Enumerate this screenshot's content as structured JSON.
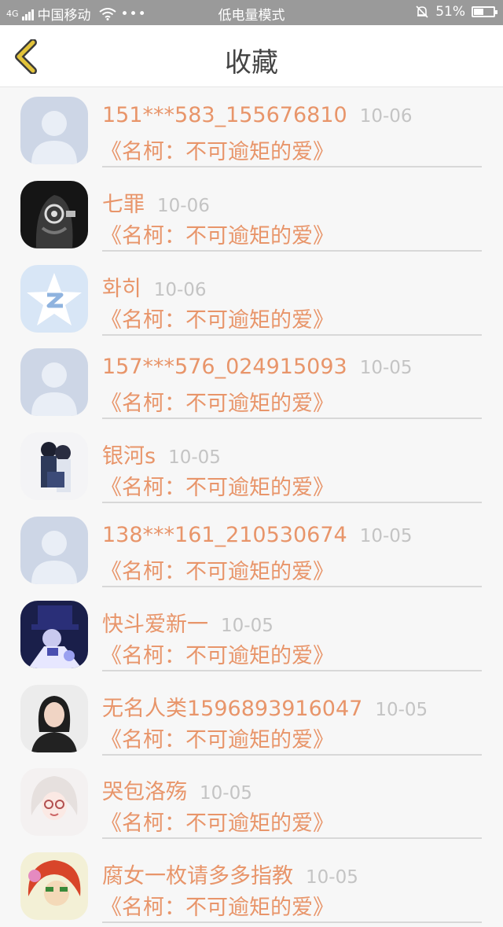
{
  "status_bar": {
    "carrier": "中国移动",
    "network": "4G",
    "mode": "低电量模式",
    "battery": "51%",
    "battery_level": 0.51,
    "icons": [
      "signal-icon",
      "wifi-icon",
      "more-dots-icon",
      "mute-bell-icon",
      "battery-icon"
    ]
  },
  "header": {
    "title": "收藏",
    "back_icon": "chevron-left-icon",
    "accent": "#e2c33a"
  },
  "colors": {
    "name": "#e8956a",
    "date": "#c4c4c4",
    "divider": "#d8d8d8",
    "background": "#f7f7f7"
  },
  "favorites": [
    {
      "name": "151***583_155676810",
      "date": "10-06",
      "work": "《名柯：不可逾矩的爱》",
      "avatar": "default-avatar"
    },
    {
      "name": "七罪",
      "date": "10-06",
      "work": "《名柯：不可逾矩的爱》",
      "avatar": "dark-photo-avatar"
    },
    {
      "name": "화히",
      "date": "10-06",
      "work": "《名柯：不可逾矩的爱》",
      "avatar": "qq-star-avatar"
    },
    {
      "name": "157***576_024915093",
      "date": "10-05",
      "work": "《名柯：不可逾矩的爱》",
      "avatar": "default-avatar"
    },
    {
      "name": "银河s",
      "date": "10-05",
      "work": "《名柯：不可逾矩的爱》",
      "avatar": "anime-couple-avatar"
    },
    {
      "name": "138***161_210530674",
      "date": "10-05",
      "work": "《名柯：不可逾矩的爱》",
      "avatar": "default-avatar"
    },
    {
      "name": "快斗爱新一",
      "date": "10-05",
      "work": "《名柯：不可逾矩的爱》",
      "avatar": "kaito-avatar"
    },
    {
      "name": "无名人类1596893916047",
      "date": "10-05",
      "work": "《名柯：不可逾矩的爱》",
      "avatar": "woman-photo-avatar"
    },
    {
      "name": "哭包洛殇",
      "date": "10-05",
      "work": "《名柯：不可逾矩的爱》",
      "avatar": "anime-white-hair-avatar"
    },
    {
      "name": "腐女一枚请多多指教",
      "date": "10-05",
      "work": "《名柯：不可逾矩的爱》",
      "avatar": "anime-red-hair-avatar"
    }
  ]
}
